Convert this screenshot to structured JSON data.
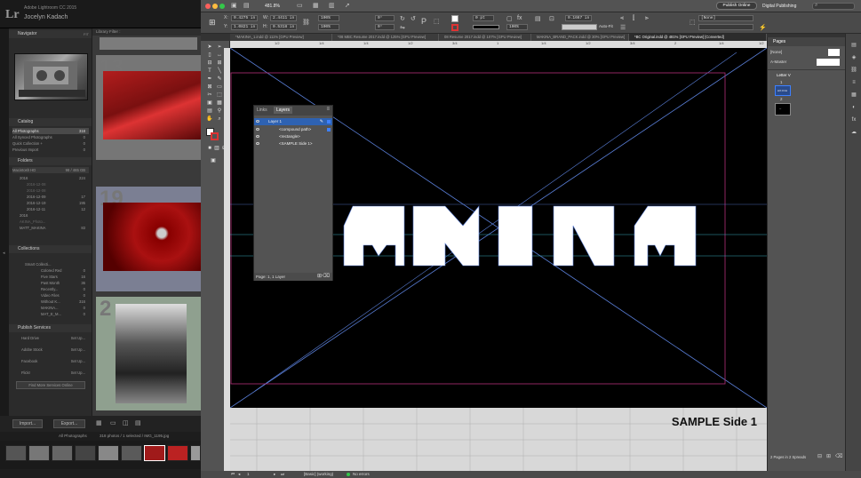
{
  "lightroom": {
    "app_title": "Adobe Lightroom CC 2015",
    "user": "Jocelyn Kadach",
    "logo": "Lr",
    "navigator": {
      "label": "Navigator",
      "zoom": [
        "FIT",
        "FILL",
        "1:1",
        "3:1"
      ]
    },
    "catalog": {
      "label": "Catalog",
      "items": [
        {
          "label": "All Photographs",
          "count": "318"
        },
        {
          "label": "All Synced Photographs",
          "count": "0"
        },
        {
          "label": "Quick Collection +",
          "count": "0"
        },
        {
          "label": "Previous Import",
          "count": "0"
        }
      ]
    },
    "folders": {
      "label": "Folders",
      "volume": "Macintosh HD",
      "volume_info": "98 / 465 GB",
      "items": [
        {
          "label": "2016",
          "count": "224"
        },
        {
          "label": "2016-12-08",
          "count": ""
        },
        {
          "label": "2016-12-08",
          "count": ""
        },
        {
          "label": "2016-12-09",
          "count": "17"
        },
        {
          "label": "2016-12-19",
          "count": "195"
        },
        {
          "label": "2016-12-11",
          "count": "12"
        },
        {
          "label": "2016",
          "count": ""
        },
        {
          "label": "AKINA_Photo...",
          "count": ""
        },
        {
          "label": "MATT_MAKINA",
          "count": "83"
        }
      ]
    },
    "collections": {
      "label": "Collections",
      "items": [
        {
          "label": "Smart Collecti...",
          "count": ""
        },
        {
          "label": "Colored Red",
          "count": "0"
        },
        {
          "label": "Five Stars",
          "count": "16"
        },
        {
          "label": "Past Month",
          "count": "36"
        },
        {
          "label": "Recently...",
          "count": "0"
        },
        {
          "label": "Video Files",
          "count": "0"
        },
        {
          "label": "Without K...",
          "count": "316"
        },
        {
          "label": "MAKINA...",
          "count": "0"
        },
        {
          "label": "MAT_E_M...",
          "count": "0"
        }
      ]
    },
    "publish": {
      "label": "Publish Services",
      "items": [
        {
          "label": "Hard Drive",
          "action": "Set Up..."
        },
        {
          "label": "Adobe Stock",
          "action": "Set Up..."
        },
        {
          "label": "Facebook",
          "action": "Set Up..."
        },
        {
          "label": "Flickr",
          "action": "Set Up..."
        }
      ],
      "find_more": "Find More Services Online"
    },
    "grid_header": "Library Filter :",
    "grid_numbers": [
      "13",
      "19",
      "2"
    ],
    "import_label": "Import...",
    "export_label": "Export...",
    "filmstrip": {
      "source": "All Photographs",
      "status": "318 photos / 1 selected / IMG_1195.jpg",
      "filter_label": "Filter :"
    }
  },
  "indesign": {
    "zoom": "481.8%",
    "publish_online": "Publish Online",
    "workspace": "Digital Publishing",
    "search_placeholder": "",
    "control": {
      "x": "0.4275 in",
      "y": "1.0821 in",
      "w": "2.4411 in",
      "h": "0.5318 in",
      "scale_x": "100%",
      "scale_y": "100%",
      "angle": "0°",
      "shear": "0°",
      "stroke": "0 pt",
      "opacity": "100%",
      "gap": "0.1667 in",
      "auto_fit": "Auto-Fit",
      "style": "[None]"
    },
    "tabs": [
      "*MAKINA_1.indd @ 111% [GPU Preview]",
      "*08 MBC Resume 2017.indd @ 125% [GPU Preview]",
      "08 Resume 2017.indd @ 107% [GPU Preview]",
      "MAKINA_BRAND_PACK.indd @ 30% [GPU Preview]",
      "*BC Original.indd @ 481% [GPU Preview] [Converted]"
    ],
    "ruler_marks": [
      "1/2",
      "1/4",
      "1/4",
      "1/2",
      "3/4",
      "1",
      "1/4",
      "1/2",
      "3/4",
      "2",
      "1/4",
      "1/2"
    ],
    "logo_text": "AKINA",
    "paste_label": "SAMPLE Side 1",
    "layers_panel": {
      "tabs": [
        "Links",
        "Layers"
      ],
      "layers": [
        {
          "label": "Layer 1",
          "selected": true
        },
        {
          "label": "<compound path>",
          "selected": false
        },
        {
          "label": "<rectangle>",
          "selected": false
        },
        {
          "label": "<SAMPLE Side 1>",
          "selected": false
        }
      ],
      "footer": "Page: 1, 1 Layer"
    },
    "pages_panel": {
      "label": "Pages",
      "none_label": "[None]",
      "master_label": "A-Master",
      "section_label": "Letter V",
      "page_numbers": [
        "1",
        "2"
      ],
      "footer": "2 Pages in 2 Spreads"
    },
    "status": {
      "page": "1",
      "style": "[Basic] (working)",
      "errors": "No errors"
    }
  },
  "colors": {
    "layer_select": "#2e62b2",
    "guide_cyan": "#3aa6b9",
    "guide_magenta": "#b5307a",
    "frame_blue": "#5a7fd8"
  }
}
